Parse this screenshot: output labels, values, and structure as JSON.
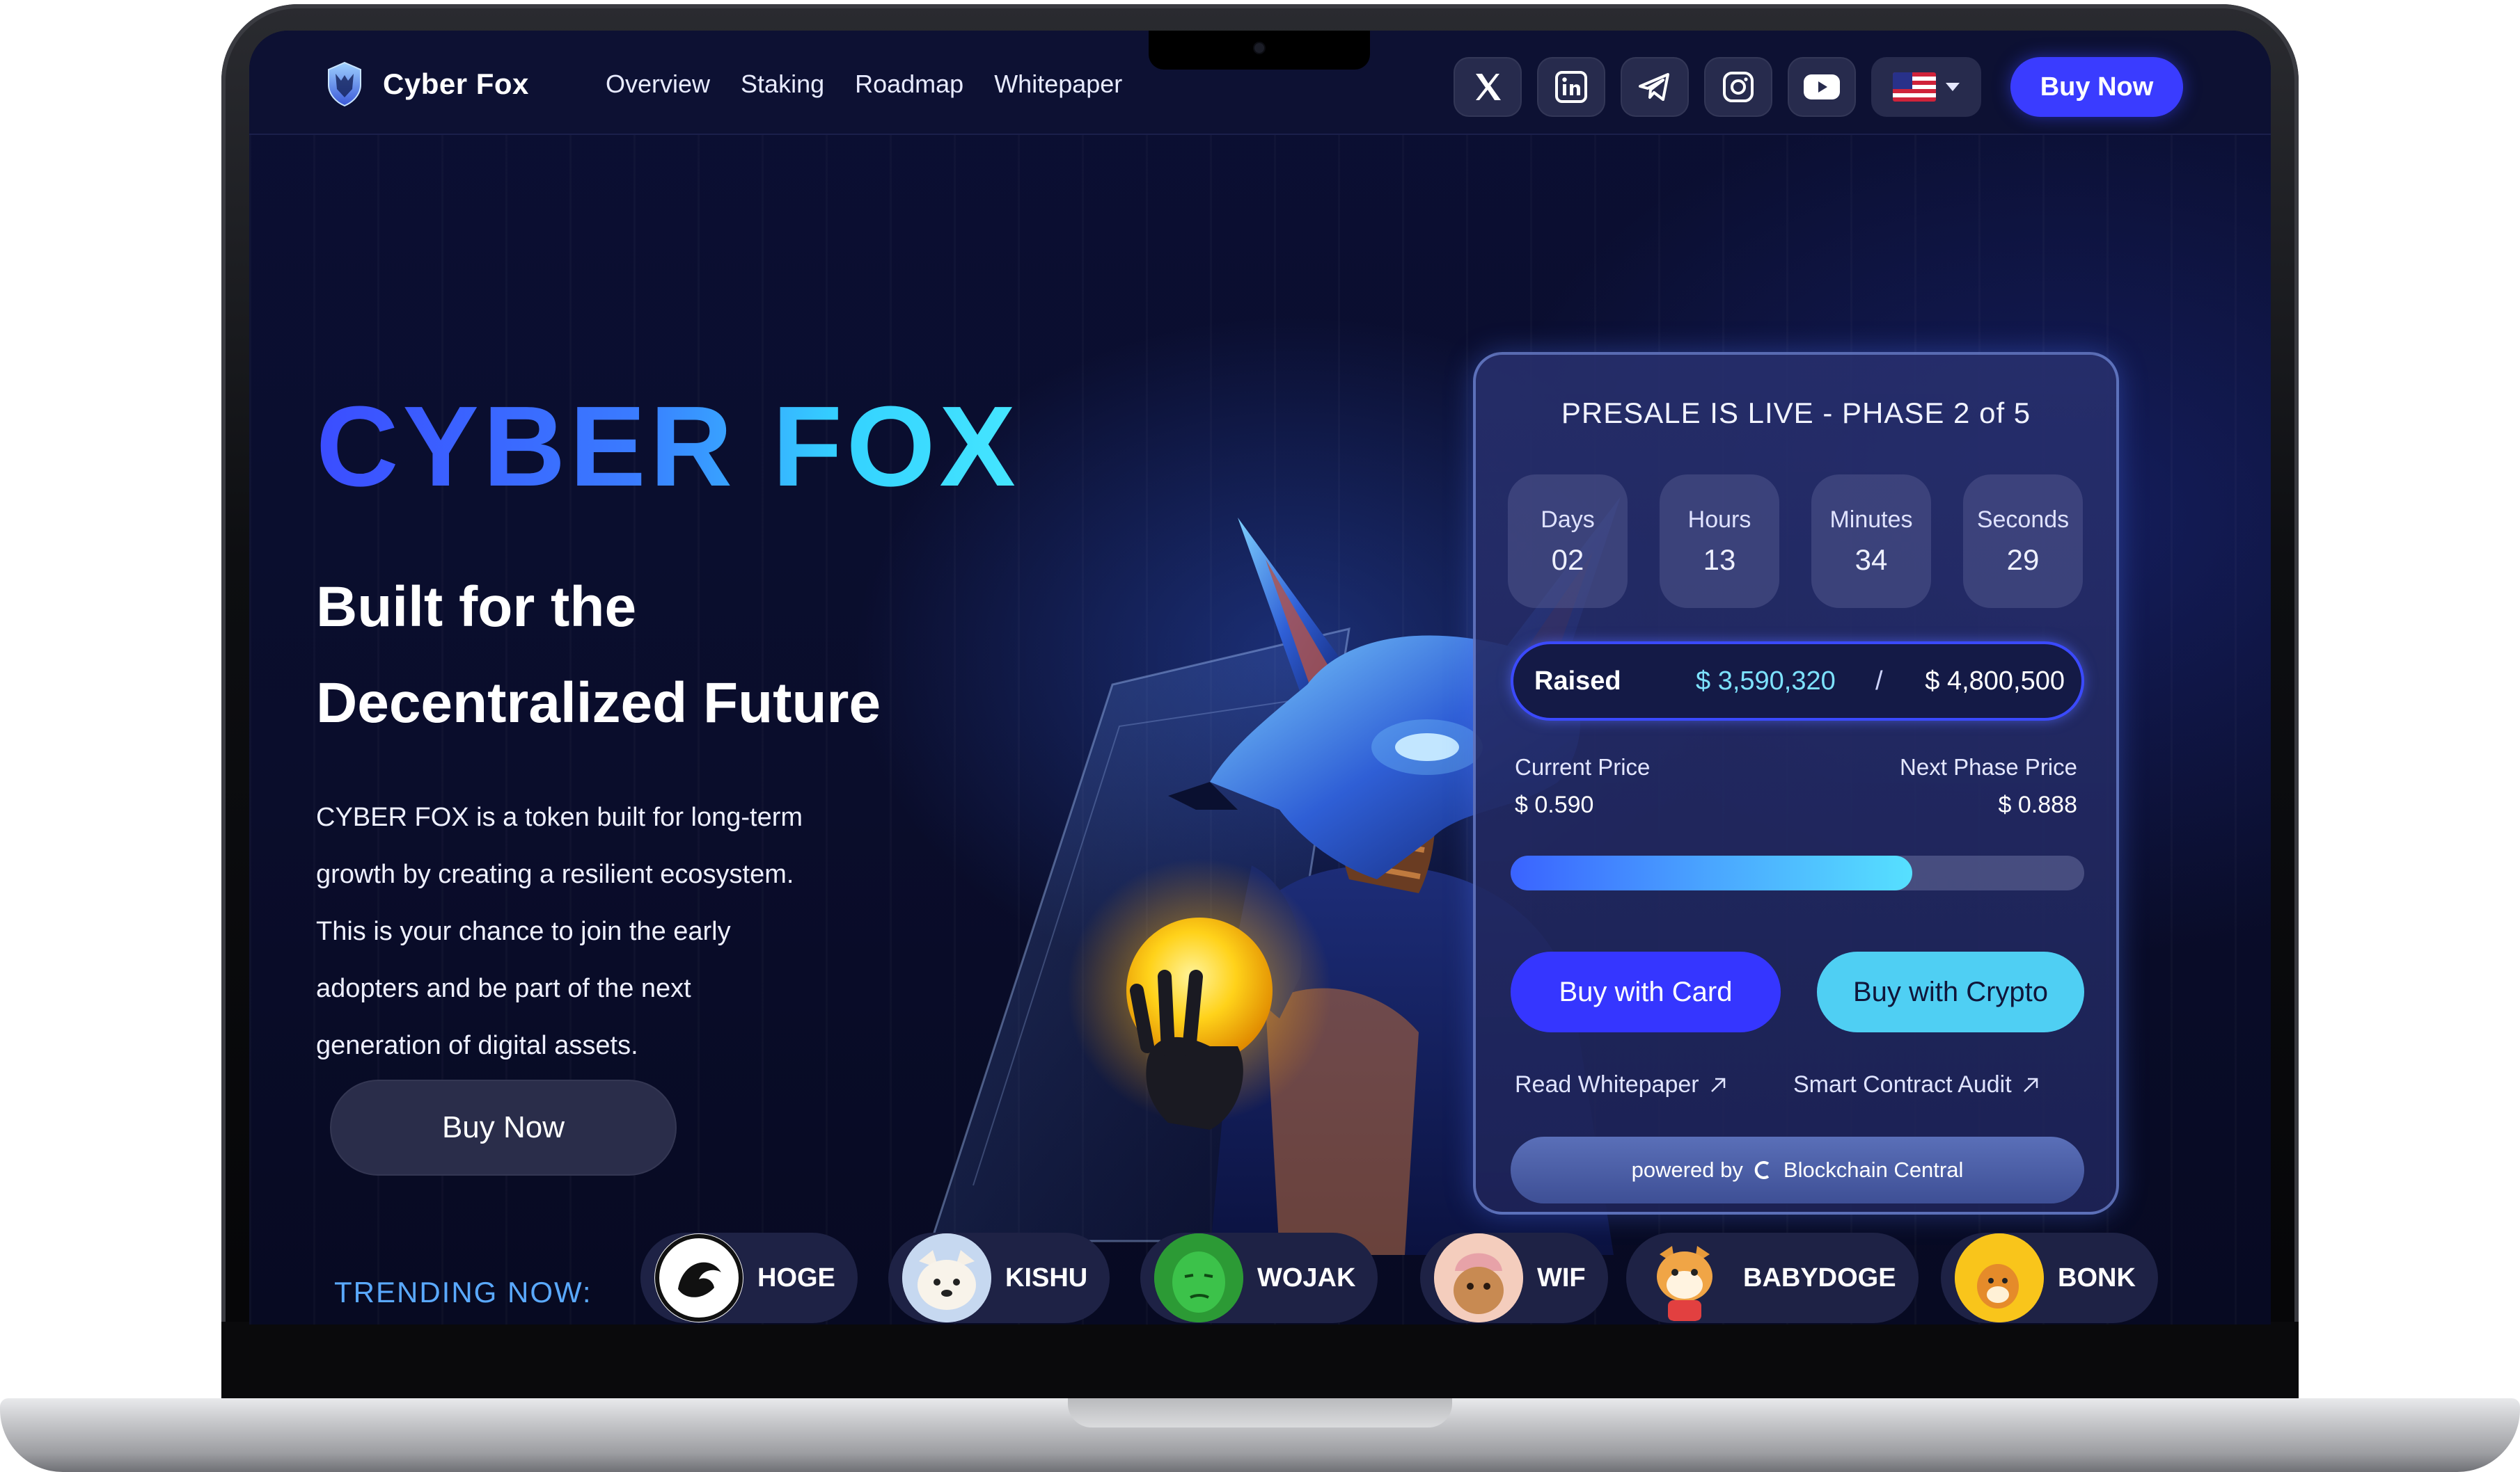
{
  "nav": {
    "brand": "Cyber Fox",
    "links": [
      "Overview",
      "Staking",
      "Roadmap",
      "Whitepaper"
    ],
    "social": [
      "x-icon",
      "linkedin-icon",
      "telegram-icon",
      "instagram-icon",
      "youtube-icon"
    ],
    "language_flag": "us-flag-icon",
    "buy_label": "Buy Now"
  },
  "hero": {
    "title": "CYBER FOX",
    "subtitle_line1": "Built for the",
    "subtitle_line2": "Decentralized Future",
    "desc_lines": [
      "CYBER FOX is a token built for long-term",
      "growth by creating a resilient ecosystem.",
      "This is your chance to join the early",
      "adopters and be part of the next",
      "generation of digital assets."
    ],
    "buy_label": "Buy Now"
  },
  "presale": {
    "title": "PRESALE IS LIVE - PHASE 2 of 5",
    "countdown": [
      {
        "label": "Days",
        "value": "02"
      },
      {
        "label": "Hours",
        "value": "13"
      },
      {
        "label": "Minutes",
        "value": "34"
      },
      {
        "label": "Seconds",
        "value": "29"
      }
    ],
    "raised_label": "Raised",
    "raised_current": "$ 3,590,320",
    "raised_separator": "/",
    "raised_target": "$ 4,800,500",
    "current_price_label": "Current Price",
    "current_price": "$ 0.590",
    "next_price_label": "Next Phase Price",
    "next_price": "$ 0.888",
    "progress_fraction": 0.7,
    "buy_card_label": "Buy with Card",
    "buy_crypto_label": "Buy with Crypto",
    "whitepaper_link": "Read Whitepaper",
    "audit_link": "Smart Contract Audit",
    "powered_prefix": "powered by",
    "powered_name": "Blockchain Central"
  },
  "trending": {
    "label": "TRENDING NOW:",
    "coins": [
      "HOGE",
      "KISHU",
      "WOJAK",
      "WIF",
      "BABYDOGE",
      "BONK"
    ]
  },
  "colors": {
    "accent": "#3a3cff",
    "cyan": "#4fcff3",
    "background": "#0a0d2b"
  }
}
